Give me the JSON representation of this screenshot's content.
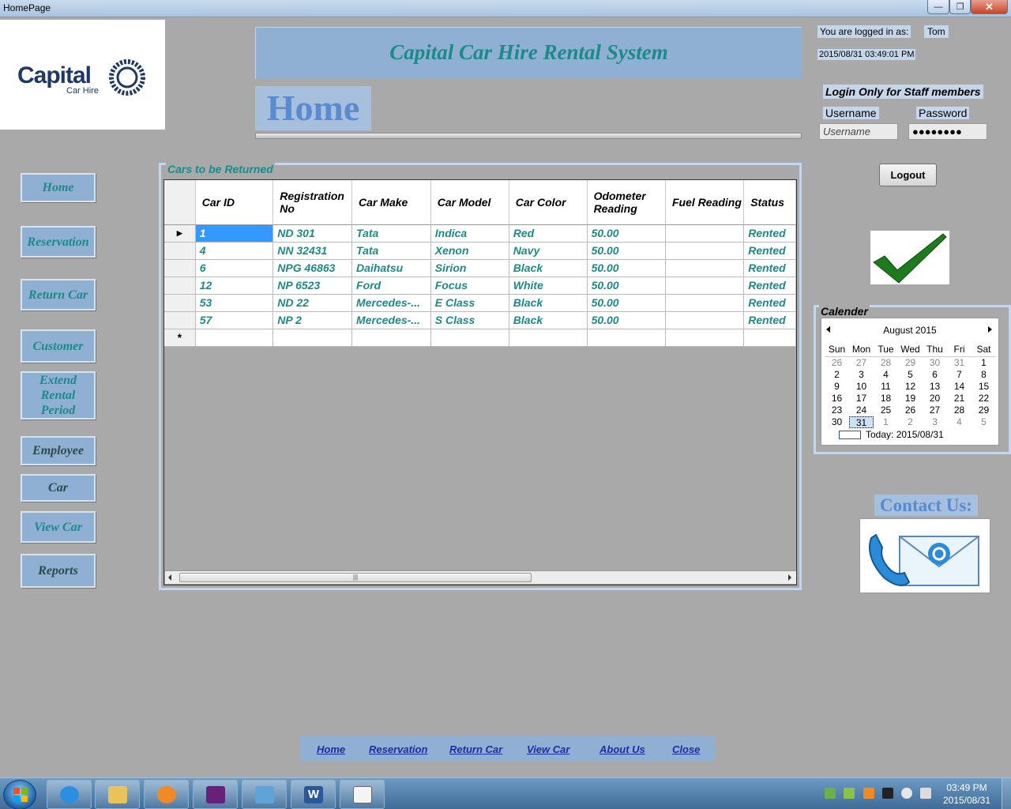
{
  "window": {
    "title": "HomePage",
    "min_glyph": "—",
    "max_glyph": "❐",
    "close_glyph": "✕"
  },
  "logo": {
    "word": "Capital",
    "sub": "Car Hire"
  },
  "header": {
    "banner": "Capital Car Hire Rental System",
    "page_title": "Home"
  },
  "session": {
    "logged_label": "You are logged in as:",
    "user": "Tom",
    "datetime": "2015/08/31 03:49:01 PM"
  },
  "login": {
    "staff_label": "Login Only for Staff members",
    "username_label": "Username",
    "password_label": "Password",
    "username_value": "Username",
    "password_value": "●●●●●●●●",
    "logout_label": "Logout"
  },
  "sidebar": {
    "items": [
      {
        "label": "Home"
      },
      {
        "label": "Reservation"
      },
      {
        "label": "Return Car"
      },
      {
        "label": "Customer"
      },
      {
        "label": "Extend Rental Period"
      },
      {
        "label": "Employee"
      },
      {
        "label": "Car"
      },
      {
        "label": "View Car"
      },
      {
        "label": "Reports"
      }
    ]
  },
  "returns": {
    "legend": "Cars to be Returned",
    "columns": [
      "Car ID",
      "Registration No",
      "Car Make",
      "Car Model",
      "Car Color",
      "Odometer Reading",
      "Fuel Reading",
      "Status"
    ],
    "rows": [
      [
        "1",
        "ND 301",
        "Tata",
        "Indica",
        "Red",
        "50.00",
        "",
        "Rented"
      ],
      [
        "4",
        "NN 32431",
        "Tata",
        "Xenon",
        "Navy",
        "50.00",
        "",
        "Rented"
      ],
      [
        "6",
        "NPG 46863",
        "Daihatsu",
        "Sirion",
        "Black",
        "50.00",
        "",
        "Rented"
      ],
      [
        "12",
        "NP 6523",
        "Ford",
        "Focus",
        "White",
        "50.00",
        "",
        "Rented"
      ],
      [
        "53",
        "ND 22",
        "Mercedes-...",
        "E Class",
        "Black",
        "50.00",
        "",
        "Rented"
      ],
      [
        "57",
        "NP 2",
        "Mercedes-...",
        "S Class",
        "Black",
        "50.00",
        "",
        "Rented"
      ]
    ],
    "current_row_marker": "▶",
    "new_row_marker": "*",
    "scroll_grip": "|||"
  },
  "calendar": {
    "legend": "Calender",
    "month": "August 2015",
    "days": [
      "Sun",
      "Mon",
      "Tue",
      "Wed",
      "Thu",
      "Fri",
      "Sat"
    ],
    "weeks": [
      [
        "26",
        "27",
        "28",
        "29",
        "30",
        "31",
        "1"
      ],
      [
        "2",
        "3",
        "4",
        "5",
        "6",
        "7",
        "8"
      ],
      [
        "9",
        "10",
        "11",
        "12",
        "13",
        "14",
        "15"
      ],
      [
        "16",
        "17",
        "18",
        "19",
        "20",
        "21",
        "22"
      ],
      [
        "23",
        "24",
        "25",
        "26",
        "27",
        "28",
        "29"
      ],
      [
        "30",
        "31",
        "1",
        "2",
        "3",
        "4",
        "5"
      ]
    ],
    "selected": "31",
    "today": "Today: 2015/08/31"
  },
  "contact": {
    "label": "Contact Us:"
  },
  "footer": {
    "links": [
      "Home",
      "Reservation",
      "Return Car",
      "View Car",
      "About Us",
      "Close"
    ]
  },
  "taskbar": {
    "time": "03:49 PM",
    "date": "2015/08/31",
    "word_letter": "W",
    "word_app_hint": "Microsoft Word"
  },
  "colors": {
    "accent_blue": "#8fb0d3",
    "teal_text": "#1b8a8a",
    "bg_gray": "#a9a9a9",
    "selected_cell": "#3399ff"
  }
}
